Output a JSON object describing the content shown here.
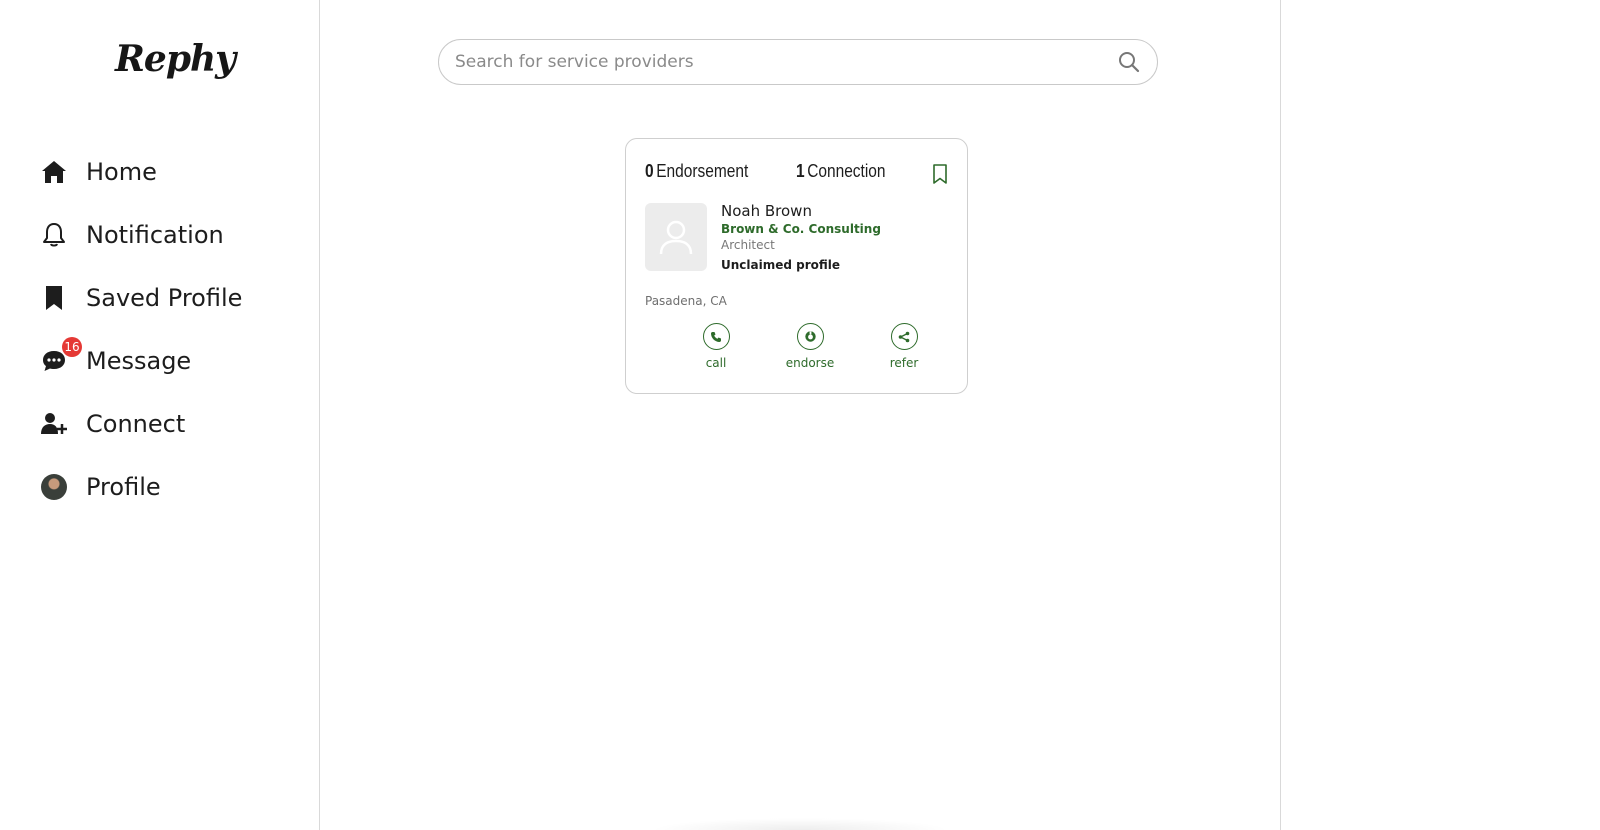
{
  "app": {
    "logo": "Rephy"
  },
  "sidebar": {
    "items": [
      {
        "label": "Home",
        "icon": "home-icon"
      },
      {
        "label": "Notification",
        "icon": "bell-icon"
      },
      {
        "label": "Saved Profile",
        "icon": "bookmark-icon"
      },
      {
        "label": "Message",
        "icon": "chat-icon",
        "badge": "16"
      },
      {
        "label": "Connect",
        "icon": "user-plus-icon"
      },
      {
        "label": "Profile",
        "icon": "avatar"
      }
    ]
  },
  "search": {
    "placeholder": "Search for service providers",
    "value": ""
  },
  "card": {
    "endorsement_count": "0",
    "endorsement_label": "Endorsement",
    "connection_count": "1",
    "connection_label": "Connection",
    "name": "Noah Brown",
    "company": "Brown & Co. Consulting",
    "role": "Architect",
    "status": "Unclaimed profile",
    "location": "Pasadena, CA",
    "actions": [
      {
        "label": "call",
        "icon": "phone-icon"
      },
      {
        "label": "endorse",
        "icon": "thumbs-up-icon"
      },
      {
        "label": "refer",
        "icon": "share-icon"
      }
    ]
  },
  "colors": {
    "accent_green": "#2e6b2b",
    "badge_red": "#e53935",
    "border": "#cfcfcf"
  }
}
